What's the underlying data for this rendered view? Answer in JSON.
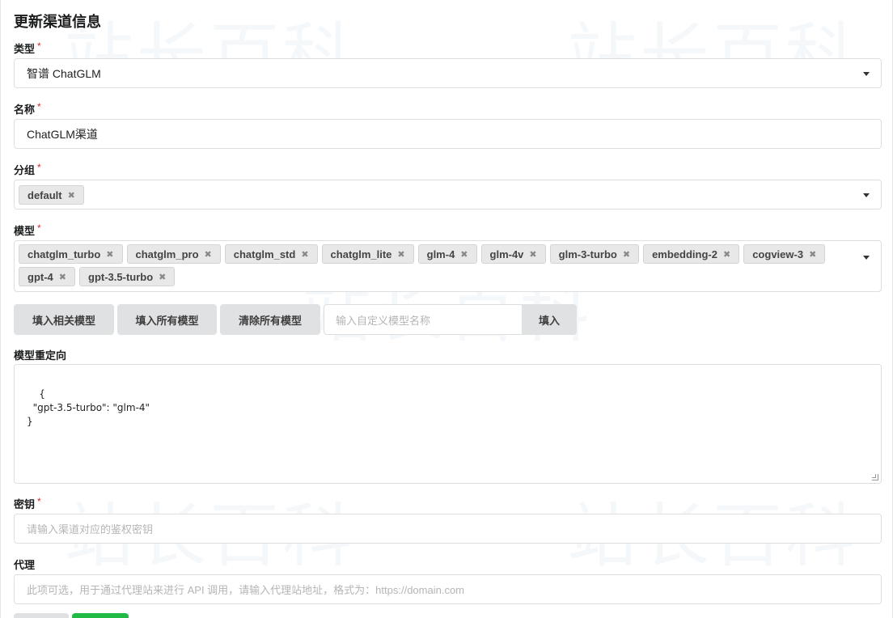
{
  "form": {
    "title": "更新渠道信息",
    "type": {
      "label": "类型",
      "value": "智谱 ChatGLM"
    },
    "name": {
      "label": "名称",
      "value": "ChatGLM渠道"
    },
    "group": {
      "label": "分组",
      "chips": [
        "default"
      ]
    },
    "models": {
      "label": "模型",
      "chips": [
        "chatglm_turbo",
        "chatglm_pro",
        "chatglm_std",
        "chatglm_lite",
        "glm-4",
        "glm-4v",
        "glm-3-turbo",
        "embedding-2",
        "cogview-3",
        "gpt-4",
        "gpt-3.5-turbo"
      ]
    },
    "buttons": {
      "fill_related": "填入相关模型",
      "fill_all": "填入所有模型",
      "clear_all": "清除所有模型",
      "custom_placeholder": "输入自定义模型名称",
      "fill": "填入"
    },
    "mapping": {
      "label": "模型重定向",
      "value": "{\n  \"gpt-3.5-turbo\": \"glm-4\"\n}"
    },
    "key": {
      "label": "密钥",
      "placeholder": "请输入渠道对应的鉴权密钥"
    },
    "proxy": {
      "label": "代理",
      "placeholder": "此项可选，用于通过代理站来进行 API 调用，请输入代理站地址，格式为：https://domain.com"
    },
    "required_mark": "*",
    "chip_remove": "✖"
  },
  "colors": {
    "required": "#db2828",
    "button_bg": "#e0e1e2",
    "primary": "#21ba45"
  }
}
